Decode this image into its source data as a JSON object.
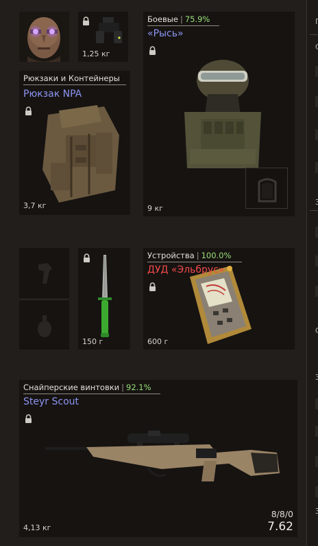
{
  "character": {
    "portrait_icon": "bald-man-portrait-icon"
  },
  "slots": {
    "nvd": {
      "weight": "1,25 кг"
    },
    "backpack": {
      "category": "Рюкзаки и Контейнеры",
      "name": "Рюкзак NPA",
      "weight": "3,7 кг"
    },
    "armor": {
      "category": "Боевые",
      "condition": "75.9%",
      "name": "«Рысь»",
      "weight": "9 кг"
    },
    "knife": {
      "weight": "150 г"
    },
    "device": {
      "category": "Устройства",
      "condition": "100.0%",
      "name": "ДУД «Эльбрус»",
      "weight": "600 г"
    },
    "rifle": {
      "category": "Снайперские винтовки",
      "condition": "92.1%",
      "name": "Steyr Scout",
      "weight": "4,13 кг",
      "ammo": "8/8/0",
      "caliber": "7.62"
    }
  },
  "right_panel": {
    "letters": [
      "Г",
      "С",
      "З",
      "С",
      "З",
      "З"
    ]
  },
  "colors": {
    "condition_green": "#9be07a",
    "name_blue": "#8d95f2",
    "name_red": "#f24b4b",
    "slot_bg": "#161311",
    "page_bg": "#221e1b"
  }
}
